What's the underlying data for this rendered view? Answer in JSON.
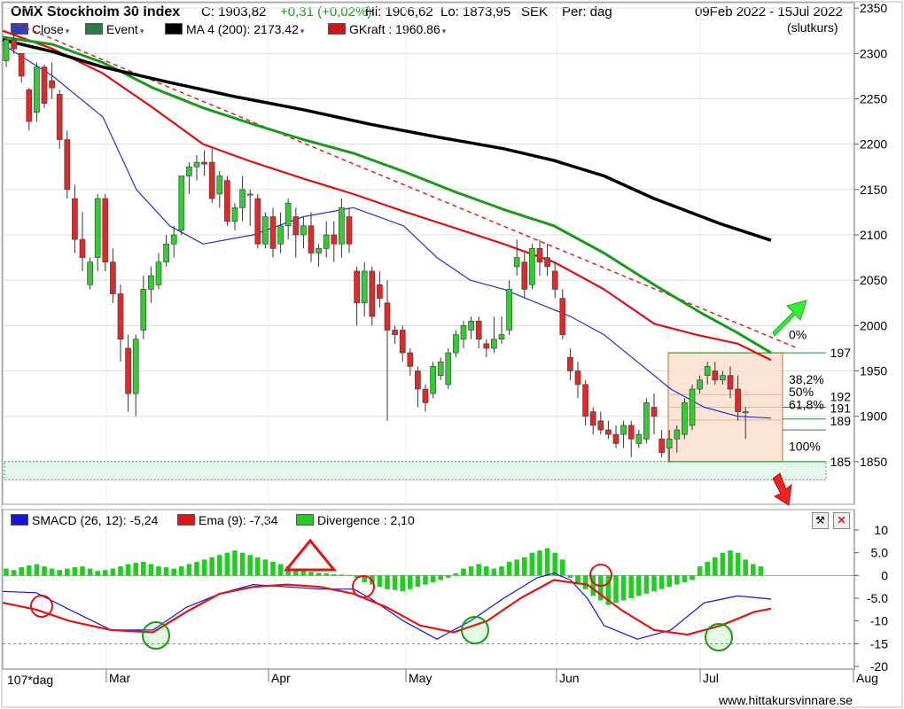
{
  "header": {
    "title": "OMX Stockholm 30 Index",
    "close_label": "C: 1903,82",
    "change": "+0,31 (+0,02%)",
    "high": "Hi: 1906,62",
    "low": "Lo: 1873,95",
    "currency": "SEK",
    "period": "Per: dag",
    "date_range": "09Feb 2022 - 15Jul 2022",
    "price_type": "(slutkurs)"
  },
  "legend": [
    {
      "label": "Close",
      "color": "#2c3fbf",
      "dropdown": true
    },
    {
      "label": "Event",
      "color": "#2d7a47",
      "dropdown": true
    },
    {
      "label": "MA 4 (200): 2173.42",
      "color": "#000000",
      "dropdown": true
    },
    {
      "label": "GKraft : 1960.86",
      "color": "#d31414",
      "dropdown": true
    }
  ],
  "indicator_legend": [
    {
      "label": "SMACD (26, 12): -5,24",
      "color": "#1414e0"
    },
    {
      "label": "Ema (9): -7,34",
      "color": "#e01414"
    },
    {
      "label": "Divergence : 2,10",
      "color": "#22cc22"
    }
  ],
  "fib_labels": {
    "p0": "0%",
    "p382": "38,2%",
    "p50": "50%",
    "p618": "61,8%",
    "p100": "100%",
    "v197": "197",
    "v192": "192",
    "v191": "191",
    "v189": "189",
    "v185": "185"
  },
  "x_labels": {
    "period": "107*dag",
    "months": [
      "Mar",
      "Apr",
      "May",
      "Jun",
      "Jul",
      "Aug"
    ]
  },
  "footer": "www.hittakursvinnare.se",
  "chart_data": [
    {
      "type": "candlestick",
      "title": "OMX Stockholm 30 Index",
      "y_ticks": [
        1850,
        1900,
        1950,
        2000,
        2050,
        2100,
        2150,
        2200,
        2250,
        2300,
        2350
      ],
      "ylim": [
        1803,
        2356
      ],
      "x_range": [
        "2022-02-09",
        "2022-08-05"
      ],
      "candles": [
        [
          2292,
          2315,
          2285,
          2315
        ],
        [
          2315,
          2322,
          2300,
          2305
        ],
        [
          2300,
          2300,
          2268,
          2275
        ],
        [
          2260,
          2262,
          2215,
          2225
        ],
        [
          2235,
          2290,
          2225,
          2285
        ],
        [
          2285,
          2288,
          2240,
          2245
        ],
        [
          2270,
          2290,
          2250,
          2262
        ],
        [
          2255,
          2260,
          2195,
          2205
        ],
        [
          2205,
          2215,
          2140,
          2150
        ],
        [
          2140,
          2155,
          2080,
          2095
        ],
        [
          2095,
          2125,
          2060,
          2075
        ],
        [
          2045,
          2075,
          2040,
          2070
        ],
        [
          2075,
          2145,
          2060,
          2140
        ],
        [
          2140,
          2145,
          2060,
          2070
        ],
        [
          2070,
          2085,
          2025,
          2035
        ],
        [
          2035,
          2045,
          1960,
          1985
        ],
        [
          1975,
          1990,
          1905,
          1925
        ],
        [
          1925,
          1990,
          1900,
          1985
        ],
        [
          1995,
          2055,
          1985,
          2040
        ],
        [
          2040,
          2065,
          2025,
          2055
        ],
        [
          2045,
          2080,
          2040,
          2070
        ],
        [
          2070,
          2100,
          2065,
          2090
        ],
        [
          2090,
          2110,
          2075,
          2100
        ],
        [
          2105,
          2160,
          2100,
          2165
        ],
        [
          2165,
          2180,
          2145,
          2175
        ],
        [
          2175,
          2188,
          2160,
          2180
        ],
        [
          2180,
          2193,
          2165,
          2178
        ],
        [
          2180,
          2195,
          2135,
          2140
        ],
        [
          2145,
          2170,
          2130,
          2165
        ],
        [
          2160,
          2165,
          2110,
          2115
        ],
        [
          2115,
          2135,
          2105,
          2130
        ],
        [
          2130,
          2165,
          2115,
          2150
        ],
        [
          2145,
          2150,
          2110,
          2145
        ],
        [
          2140,
          2145,
          2085,
          2090
        ],
        [
          2090,
          2125,
          2085,
          2120
        ],
        [
          2120,
          2130,
          2075,
          2085
        ],
        [
          2090,
          2125,
          2080,
          2110
        ],
        [
          2110,
          2140,
          2095,
          2135
        ],
        [
          2120,
          2130,
          2075,
          2100
        ],
        [
          2100,
          2120,
          2085,
          2110
        ],
        [
          2110,
          2125,
          2070,
          2080
        ],
        [
          2080,
          2090,
          2065,
          2085
        ],
        [
          2085,
          2115,
          2075,
          2100
        ],
        [
          2100,
          2115,
          2070,
          2090
        ],
        [
          2090,
          2140,
          2075,
          2130
        ],
        [
          2120,
          2130,
          2080,
          2090
        ],
        [
          2060,
          2065,
          2000,
          2025
        ],
        [
          2025,
          2070,
          2010,
          2060
        ],
        [
          2060,
          2065,
          2000,
          2010
        ],
        [
          2045,
          2060,
          2020,
          2030
        ],
        [
          2025,
          2050,
          1895,
          1995
        ],
        [
          1995,
          2000,
          1980,
          1990
        ],
        [
          1995,
          2000,
          1960,
          1970
        ],
        [
          1970,
          1975,
          1945,
          1955
        ],
        [
          1950,
          1955,
          1910,
          1930
        ],
        [
          1930,
          1935,
          1905,
          1915
        ],
        [
          1925,
          1960,
          1920,
          1955
        ],
        [
          1945,
          1965,
          1940,
          1960
        ],
        [
          1935,
          1975,
          1930,
          1970
        ],
        [
          1970,
          1995,
          1965,
          1990
        ],
        [
          1985,
          2005,
          1975,
          2000
        ],
        [
          1995,
          2010,
          1985,
          2005
        ],
        [
          2005,
          2010,
          1975,
          1985
        ],
        [
          1980,
          1985,
          1965,
          1975
        ],
        [
          1975,
          2010,
          1970,
          1985
        ],
        [
          1985,
          2010,
          1980,
          1990
        ],
        [
          1995,
          2050,
          1990,
          2040
        ],
        [
          2065,
          2095,
          2055,
          2075
        ],
        [
          2070,
          2080,
          2030,
          2040
        ],
        [
          2045,
          2090,
          2040,
          2085
        ],
        [
          2085,
          2095,
          2055,
          2070
        ],
        [
          2075,
          2090,
          2055,
          2065
        ],
        [
          2060,
          2070,
          2030,
          2040
        ],
        [
          2030,
          2040,
          1985,
          1990
        ],
        [
          1965,
          1975,
          1940,
          1950
        ],
        [
          1950,
          1960,
          1920,
          1935
        ],
        [
          1935,
          1940,
          1890,
          1900
        ],
        [
          1905,
          1910,
          1880,
          1890
        ],
        [
          1895,
          1905,
          1880,
          1885
        ],
        [
          1885,
          1895,
          1875,
          1880
        ],
        [
          1880,
          1890,
          1865,
          1870
        ],
        [
          1880,
          1895,
          1865,
          1890
        ],
        [
          1890,
          1895,
          1855,
          1875
        ],
        [
          1870,
          1885,
          1865,
          1880
        ],
        [
          1875,
          1920,
          1870,
          1915
        ],
        [
          1910,
          1925,
          1880,
          1900
        ],
        [
          1875,
          1885,
          1855,
          1860
        ],
        [
          1865,
          1885,
          1850,
          1875
        ],
        [
          1875,
          1890,
          1860,
          1885
        ],
        [
          1880,
          1920,
          1875,
          1915
        ],
        [
          1890,
          1935,
          1885,
          1930
        ],
        [
          1930,
          1945,
          1925,
          1940
        ],
        [
          1945,
          1960,
          1935,
          1955
        ],
        [
          1950,
          1960,
          1935,
          1940
        ],
        [
          1940,
          1950,
          1935,
          1945
        ],
        [
          1945,
          1955,
          1920,
          1930
        ],
        [
          1930,
          1945,
          1895,
          1905
        ],
        [
          1905,
          1910,
          1875,
          1905
        ]
      ],
      "ma200": [
        [
          0,
          2315
        ],
        [
          60,
          2302
        ],
        [
          120,
          2285
        ],
        [
          200,
          2268
        ],
        [
          280,
          2252
        ],
        [
          360,
          2238
        ],
        [
          440,
          2222
        ],
        [
          520,
          2208
        ],
        [
          600,
          2195
        ],
        [
          660,
          2182
        ],
        [
          720,
          2165
        ],
        [
          780,
          2140
        ],
        [
          860,
          2112
        ],
        [
          920,
          2094
        ]
      ],
      "ma_green": [
        [
          0,
          2318
        ],
        [
          60,
          2310
        ],
        [
          120,
          2290
        ],
        [
          180,
          2262
        ],
        [
          240,
          2240
        ],
        [
          300,
          2222
        ],
        [
          360,
          2205
        ],
        [
          420,
          2190
        ],
        [
          480,
          2170
        ],
        [
          540,
          2148
        ],
        [
          600,
          2128
        ],
        [
          660,
          2110
        ],
        [
          720,
          2080
        ],
        [
          780,
          2045
        ],
        [
          840,
          2012
        ],
        [
          880,
          1992
        ],
        [
          920,
          1970
        ]
      ],
      "gkraft": [
        [
          0,
          2325
        ],
        [
          60,
          2305
        ],
        [
          120,
          2278
        ],
        [
          180,
          2240
        ],
        [
          240,
          2200
        ],
        [
          300,
          2180
        ],
        [
          360,
          2162
        ],
        [
          420,
          2145
        ],
        [
          480,
          2126
        ],
        [
          540,
          2108
        ],
        [
          600,
          2090
        ],
        [
          660,
          2070
        ],
        [
          720,
          2040
        ],
        [
          780,
          2002
        ],
        [
          830,
          1990
        ],
        [
          880,
          1980
        ],
        [
          920,
          1962
        ]
      ],
      "ma_blue": [
        [
          0,
          2310
        ],
        [
          60,
          2275
        ],
        [
          120,
          2230
        ],
        [
          160,
          2150
        ],
        [
          200,
          2110
        ],
        [
          240,
          2090
        ],
        [
          300,
          2100
        ],
        [
          360,
          2120
        ],
        [
          420,
          2130
        ],
        [
          480,
          2110
        ],
        [
          520,
          2075
        ],
        [
          560,
          2050
        ],
        [
          600,
          2040
        ],
        [
          640,
          2025
        ],
        [
          680,
          2010
        ],
        [
          720,
          1990
        ],
        [
          760,
          1960
        ],
        [
          800,
          1930
        ],
        [
          840,
          1910
        ],
        [
          880,
          1900
        ],
        [
          920,
          1898
        ]
      ],
      "fib": {
        "top": 1970,
        "bottom": 1850,
        "levels": [
          {
            "pct": "38,2%",
            "value": 1924
          },
          {
            "pct": "50%",
            "value": 1910
          },
          {
            "pct": "61,8%",
            "value": 1896
          }
        ]
      },
      "support_band": [
        1830,
        1850
      ]
    },
    {
      "type": "bar+line",
      "title": "SMACD (26, 12)",
      "y_ticks": [
        10,
        5,
        0,
        -5,
        -10,
        -15,
        -20
      ],
      "y_tick_labels": [
        "10",
        "5.0",
        "0",
        "-5.0",
        "-10",
        "-15",
        "-20"
      ],
      "ylim": [
        -20,
        10
      ],
      "divergence": [
        1.5,
        1.2,
        1.8,
        2.2,
        2.5,
        2.0,
        1.5,
        1.2,
        1.5,
        1.8,
        2.0,
        1.5,
        1.0,
        1.2,
        1.5,
        2.0,
        2.5,
        2.8,
        3.0,
        2.5,
        2.0,
        1.8,
        1.5,
        2.0,
        2.5,
        3.0,
        3.5,
        4.0,
        4.5,
        5.0,
        5.5,
        5.0,
        4.5,
        4.0,
        3.5,
        3.0,
        2.5,
        2.0,
        1.5,
        1.0,
        0.8,
        0.6,
        0.5,
        0.3,
        0.2,
        0.1,
        -0.5,
        -1.5,
        -2.0,
        -2.5,
        -3.0,
        -3.2,
        -3.5,
        -3.0,
        -2.5,
        -2.0,
        -1.5,
        -1.0,
        -0.5,
        0.5,
        1.5,
        2.0,
        2.5,
        2.0,
        1.5,
        2.0,
        3.0,
        3.5,
        4.0,
        5.0,
        5.5,
        6.0,
        5.0,
        3.5,
        -0.5,
        -1.5,
        -3.0,
        -4.5,
        -5.5,
        -6.5,
        -6.0,
        -5.5,
        -5.0,
        -4.5,
        -4.0,
        -3.5,
        -3.0,
        -2.5,
        -2.0,
        -1.5,
        -1.0,
        2.0,
        3.0,
        4.0,
        5.0,
        5.5,
        5.0,
        3.5,
        2.5,
        2.0
      ],
      "smacd": [
        [
          0,
          -3.5
        ],
        [
          40,
          -3.8
        ],
        [
          80,
          -7.5
        ],
        [
          130,
          -12
        ],
        [
          180,
          -12
        ],
        [
          220,
          -7
        ],
        [
          260,
          -4
        ],
        [
          300,
          -2
        ],
        [
          340,
          -2.5
        ],
        [
          380,
          -3
        ],
        [
          420,
          -3
        ],
        [
          440,
          -5
        ],
        [
          480,
          -10
        ],
        [
          520,
          -14
        ],
        [
          560,
          -10
        ],
        [
          600,
          -5
        ],
        [
          640,
          -0.5
        ],
        [
          660,
          0.5
        ],
        [
          680,
          -1
        ],
        [
          700,
          -5
        ],
        [
          720,
          -11
        ],
        [
          760,
          -14
        ],
        [
          800,
          -12
        ],
        [
          840,
          -6
        ],
        [
          880,
          -4.5
        ],
        [
          920,
          -5.2
        ]
      ],
      "ema": [
        [
          0,
          -6
        ],
        [
          40,
          -7.5
        ],
        [
          80,
          -10
        ],
        [
          130,
          -12
        ],
        [
          180,
          -12.5
        ],
        [
          220,
          -8
        ],
        [
          260,
          -4
        ],
        [
          300,
          -2.5
        ],
        [
          340,
          -2
        ],
        [
          380,
          -2.5
        ],
        [
          420,
          -4
        ],
        [
          460,
          -7
        ],
        [
          500,
          -11
        ],
        [
          540,
          -12.5
        ],
        [
          580,
          -10
        ],
        [
          620,
          -5
        ],
        [
          660,
          -1
        ],
        [
          700,
          -2
        ],
        [
          740,
          -7.5
        ],
        [
          780,
          -12
        ],
        [
          820,
          -13
        ],
        [
          860,
          -11
        ],
        [
          900,
          -8
        ],
        [
          920,
          -7.3
        ]
      ]
    }
  ]
}
